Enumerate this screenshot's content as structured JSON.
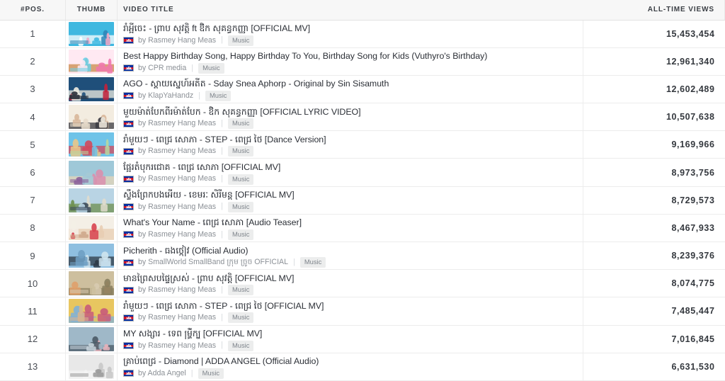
{
  "table": {
    "headers": {
      "position": "#POS.",
      "thumb": "THUMB",
      "title": "VIDEO TITLE",
      "views": "ALL-TIME VIEWS"
    },
    "separator": "|",
    "by_prefix": "by ",
    "flag_name": "cambodia-flag-icon",
    "rows": [
      {
        "pos": "1",
        "title": "រាំអ្អីចេះ - ព្រាប សុវត្តិ ft ឱិក សុគន្ធកញ្ញា [OFFICIAL MV]",
        "channel": "Rasmey Hang Meas",
        "category": "Music",
        "views": "15,453,454",
        "thumb_colors": [
          "#3fb8e0",
          "#f2a8c6",
          "#ffffff",
          "#2d86b8"
        ]
      },
      {
        "pos": "2",
        "title": "Best Happy Birthday Song, Happy Birthday To You, Birthday Song for Kids (Vuthyro's Birthday)",
        "channel": "CPR media",
        "category": "Music",
        "views": "12,961,340",
        "thumb_colors": [
          "#ffe9f2",
          "#f178ae",
          "#c98a4a",
          "#6fd0e8"
        ]
      },
      {
        "pos": "3",
        "title": "AGO - ស្ដាយស្នេហ៍អតីត - Sday Snea Aphorp - Original by Sin Sisamuth",
        "channel": "KlapYaHandz",
        "category": "Music",
        "views": "12,602,489",
        "thumb_colors": [
          "#1f4f7a",
          "#c2203a",
          "#f0ece2",
          "#2a2f3a"
        ]
      },
      {
        "pos": "4",
        "title": "មួយម៉ាត់បែកពីរម៉ាត់បែក - ឱិក សុគន្ធកញ្ញា [OFFICIAL LYRIC VIDEO]",
        "channel": "Rasmey Hang Meas",
        "category": "Music",
        "views": "10,507,638",
        "thumb_colors": [
          "#f3ece0",
          "#d8b79a",
          "#3b3b42",
          "#e8dccb"
        ]
      },
      {
        "pos": "5",
        "title": "រាំមួយៗ - ពេជ្រ សោភា - STEP - ពេជ្រ ថៃ [Dance Version]",
        "channel": "Rasmey Hang Meas",
        "category": "Music",
        "views": "9,169,966",
        "thumb_colors": [
          "#6fc3e8",
          "#e8c88a",
          "#d2495c",
          "#b8d8a0"
        ]
      },
      {
        "pos": "6",
        "title": "ផ្អែរតំបុករជោគ - ពេជ្រ សោភា [OFFICIAL MV]",
        "channel": "Rasmey Hang Meas",
        "category": "Music",
        "views": "8,973,756",
        "thumb_colors": [
          "#9fc8d8",
          "#d98fae",
          "#e5d6b8",
          "#8a5f9a"
        ]
      },
      {
        "pos": "7",
        "title": "ស្ទឹងព្រែកបងអើយ - ខេមរៈ សិរីមន្ត [OFFICIAL MV]",
        "channel": "Rasmey Hang Meas",
        "category": "Music",
        "views": "8,729,573",
        "thumb_colors": [
          "#b9d4e4",
          "#e0dccd",
          "#6e8f4f",
          "#3c4a5c"
        ]
      },
      {
        "pos": "8",
        "title": "What's Your Name - ពេជ្រ សោភា [Audio Teaser]",
        "channel": "Rasmey Hang Meas",
        "category": "Music",
        "views": "8,467,933",
        "thumb_colors": [
          "#f4efe6",
          "#d8434f",
          "#e8cdb2",
          "#cfa98c"
        ]
      },
      {
        "pos": "9",
        "title": "Picherith - ធងថ្កៀវ (Official Audio)",
        "channel": "SmallWorld SmallBand ក្រុម ច្រូច OFFICIAL",
        "category": "Music",
        "views": "8,239,376",
        "thumb_colors": [
          "#8fbfe0",
          "#cfe4ee",
          "#2e3a46",
          "#6fa0c4"
        ]
      },
      {
        "pos": "10",
        "title": "មានព្រៃសបផ្ទៃស្រស់ - ព្រាប សុវត្តិ [OFFICIAL MV]",
        "channel": "Rasmey Hang Meas",
        "category": "Music",
        "views": "8,074,775",
        "thumb_colors": [
          "#cdbf9e",
          "#e0a06a",
          "#8a7f5f",
          "#d8cbb0"
        ]
      },
      {
        "pos": "11",
        "title": "រាំមួយៗ - ពេជ្រ សោភា - STEP - ពេជ្រ ថៃ [OFFICIAL MV]",
        "channel": "Rasmey Hang Meas",
        "category": "Music",
        "views": "7,485,447",
        "thumb_colors": [
          "#e8c660",
          "#c85a7a",
          "#7fb0d8",
          "#dcb48c"
        ]
      },
      {
        "pos": "12",
        "title": "MY សង្សារ - ទេព ម្ហ្រី់ក្បួ [OFFICIAL MV]",
        "channel": "Rasmey Hang Meas",
        "category": "Music",
        "views": "7,016,845",
        "thumb_colors": [
          "#9fb8c8",
          "#e8b0b8",
          "#4a5a66",
          "#c8d4dc"
        ]
      },
      {
        "pos": "13",
        "title": "គ្រាប់ពេជ្រ - Diamond | ADDA ANGEL (Official Audio)",
        "channel": "Adda Angel",
        "category": "Music",
        "views": "6,631,530",
        "thumb_colors": [
          "#e8e8e8",
          "#c8c8c8",
          "#f4f4f4",
          "#9a9a9a"
        ]
      }
    ]
  }
}
